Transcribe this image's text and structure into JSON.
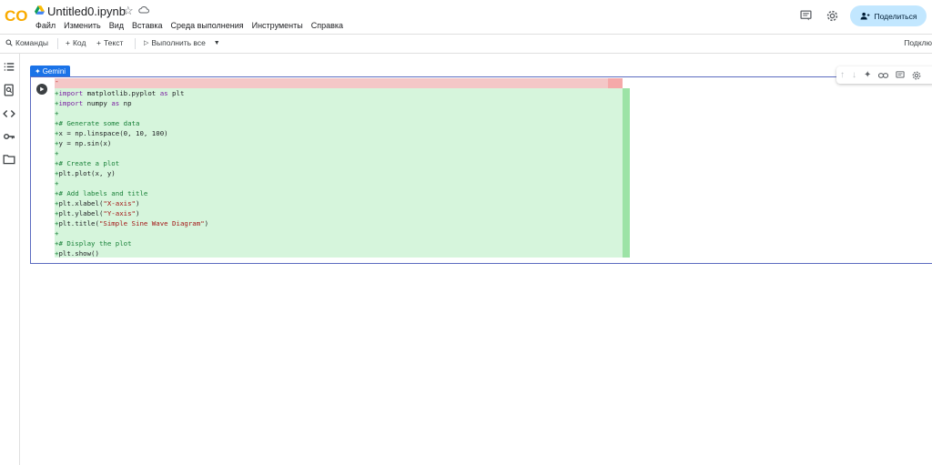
{
  "app": {
    "title": "Untitled0.ipynb",
    "logo_text": "CO",
    "brand_color": "#f9ab00"
  },
  "menu": [
    "Файл",
    "Изменить",
    "Вид",
    "Вставка",
    "Среда выполнения",
    "Инструменты",
    "Справка"
  ],
  "header_right": {
    "share_label": "Поделиться",
    "icons": [
      "comment-icon",
      "settings-icon",
      "person-add-icon"
    ]
  },
  "toolbar": {
    "commands": "Команды",
    "code": "Код",
    "text": "Текст",
    "run_all": "Выполнить все",
    "connect": "Подклю"
  },
  "sidebar_icons": [
    "table-of-contents-icon",
    "find-icon",
    "code-snippets-icon",
    "secrets-key-icon",
    "files-folder-icon"
  ],
  "gemini_label": "Gemini",
  "cell": {
    "removed_line": "-",
    "code_lines": [
      {
        "prefix": "+",
        "tokens": [
          [
            "kw",
            "import"
          ],
          [
            "",
            " matplotlib.pyplot "
          ],
          [
            "kw",
            "as"
          ],
          [
            "",
            " plt"
          ]
        ]
      },
      {
        "prefix": "+",
        "tokens": [
          [
            "kw",
            "import"
          ],
          [
            "",
            " numpy "
          ],
          [
            "kw",
            "as"
          ],
          [
            "",
            " np"
          ]
        ]
      },
      {
        "prefix": "+",
        "tokens": []
      },
      {
        "prefix": "+",
        "tokens": [
          [
            "cm",
            "# Generate some data"
          ]
        ]
      },
      {
        "prefix": "+",
        "tokens": [
          [
            "",
            "x = np.linspace(0, 10, 100)"
          ]
        ]
      },
      {
        "prefix": "+",
        "tokens": [
          [
            "",
            "y = np.sin(x)"
          ]
        ]
      },
      {
        "prefix": "+",
        "tokens": []
      },
      {
        "prefix": "+",
        "tokens": [
          [
            "cm",
            "# Create a plot"
          ]
        ]
      },
      {
        "prefix": "+",
        "tokens": [
          [
            "",
            "plt.plot(x, y)"
          ]
        ]
      },
      {
        "prefix": "+",
        "tokens": []
      },
      {
        "prefix": "+",
        "tokens": [
          [
            "cm",
            "# Add labels and title"
          ]
        ]
      },
      {
        "prefix": "+",
        "tokens": [
          [
            "",
            "plt.xlabel("
          ],
          [
            "str",
            "\"X-axis\""
          ],
          [
            "",
            ")"
          ]
        ]
      },
      {
        "prefix": "+",
        "tokens": [
          [
            "",
            "plt.ylabel("
          ],
          [
            "str",
            "\"Y-axis\""
          ],
          [
            "",
            ")"
          ]
        ]
      },
      {
        "prefix": "+",
        "tokens": [
          [
            "",
            "plt.title("
          ],
          [
            "str",
            "\"Simple Sine Wave Diagram\""
          ],
          [
            "",
            ")"
          ]
        ]
      },
      {
        "prefix": "+",
        "tokens": []
      },
      {
        "prefix": "+",
        "tokens": [
          [
            "cm",
            "# Display the plot"
          ]
        ]
      },
      {
        "prefix": "+",
        "tokens": [
          [
            "",
            "plt.show()"
          ]
        ]
      }
    ]
  },
  "cell_toolbar_icons": [
    "move-up-icon",
    "move-down-icon",
    "gemini-sparkle-icon",
    "link-icon",
    "comment-icon",
    "settings-icon"
  ]
}
